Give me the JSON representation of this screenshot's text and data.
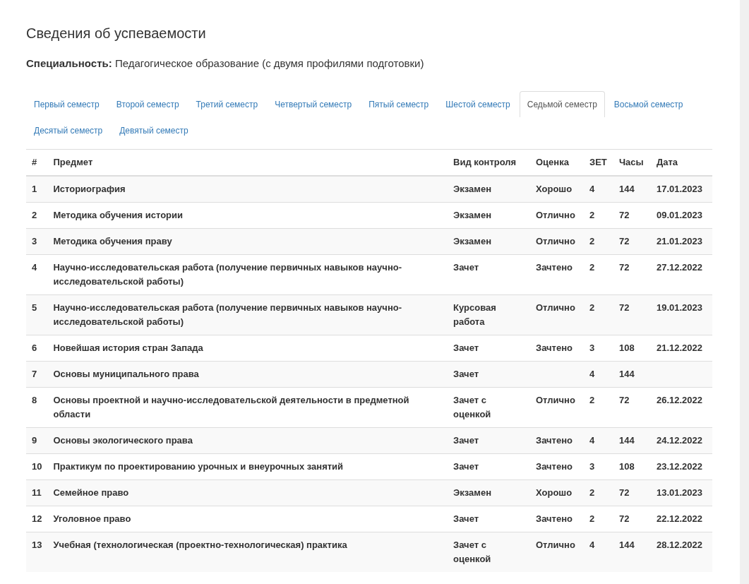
{
  "title": "Сведения об успеваемости",
  "specialty": {
    "label": "Специальность:",
    "value": "Педагогическое образование (с двумя профилями подготовки)"
  },
  "tabs": [
    {
      "label": "Первый семестр",
      "selected": false
    },
    {
      "label": "Второй семестр",
      "selected": false
    },
    {
      "label": "Третий семестр",
      "selected": false
    },
    {
      "label": "Четвертый семестр",
      "selected": false
    },
    {
      "label": "Пятый семестр",
      "selected": false
    },
    {
      "label": "Шестой семестр",
      "selected": false
    },
    {
      "label": "Седьмой семестр",
      "selected": true
    },
    {
      "label": "Восьмой семестр",
      "selected": false
    },
    {
      "label": "Десятый семестр",
      "selected": false
    },
    {
      "label": "Девятый семестр",
      "selected": false
    }
  ],
  "table": {
    "columns": [
      "#",
      "Предмет",
      "Вид контроля",
      "Оценка",
      "ЗЕТ",
      "Часы",
      "Дата"
    ],
    "rows": [
      {
        "n": "1",
        "subject": "Историография",
        "control": "Экзамен",
        "grade": "Хорошо",
        "zet": "4",
        "hours": "144",
        "date": "17.01.2023"
      },
      {
        "n": "2",
        "subject": "Методика обучения истории",
        "control": "Экзамен",
        "grade": "Отлично",
        "zet": "2",
        "hours": "72",
        "date": "09.01.2023"
      },
      {
        "n": "3",
        "subject": "Методика обучения праву",
        "control": "Экзамен",
        "grade": "Отлично",
        "zet": "2",
        "hours": "72",
        "date": "21.01.2023"
      },
      {
        "n": "4",
        "subject": "Научно-исследовательская работа (получение первичных навыков научно-исследовательской работы)",
        "control": "Зачет",
        "grade": "Зачтено",
        "zet": "2",
        "hours": "72",
        "date": "27.12.2022"
      },
      {
        "n": "5",
        "subject": "Научно-исследовательская работа (получение первичных навыков научно-исследовательской работы)",
        "control": "Курсовая работа",
        "grade": "Отлично",
        "zet": "2",
        "hours": "72",
        "date": "19.01.2023"
      },
      {
        "n": "6",
        "subject": "Новейшая история стран Запада",
        "control": "Зачет",
        "grade": "Зачтено",
        "zet": "3",
        "hours": "108",
        "date": "21.12.2022"
      },
      {
        "n": "7",
        "subject": "Основы муниципального права",
        "control": "Зачет",
        "zet": "4",
        "hours": "144"
      },
      {
        "n": "8",
        "subject": "Основы проектной и научно-исследовательской деятельности в предметной области",
        "control": "Зачет с оценкой",
        "grade": "Отлично",
        "zet": "2",
        "hours": "72",
        "date": "26.12.2022"
      },
      {
        "n": "9",
        "subject": "Основы экологического права",
        "control": "Зачет",
        "grade": "Зачтено",
        "zet": "4",
        "hours": "144",
        "date": "24.12.2022"
      },
      {
        "n": "10",
        "subject": "Практикум по проектированию урочных и внеурочных занятий",
        "control": "Зачет",
        "grade": "Зачтено",
        "zet": "3",
        "hours": "108",
        "date": "23.12.2022"
      },
      {
        "n": "11",
        "subject": "Семейное право",
        "control": "Экзамен",
        "grade": "Хорошо",
        "zet": "2",
        "hours": "72",
        "date": "13.01.2023"
      },
      {
        "n": "12",
        "subject": "Уголовное право",
        "control": "Зачет",
        "grade": "Зачтено",
        "zet": "2",
        "hours": "72",
        "date": "22.12.2022"
      },
      {
        "n": "13",
        "subject": "Учебная (технологическая (проектно-технологическая) практика",
        "control": "Зачет с оценкой",
        "grade": "Отлично",
        "zet": "4",
        "hours": "144",
        "date": "28.12.2022"
      }
    ]
  }
}
